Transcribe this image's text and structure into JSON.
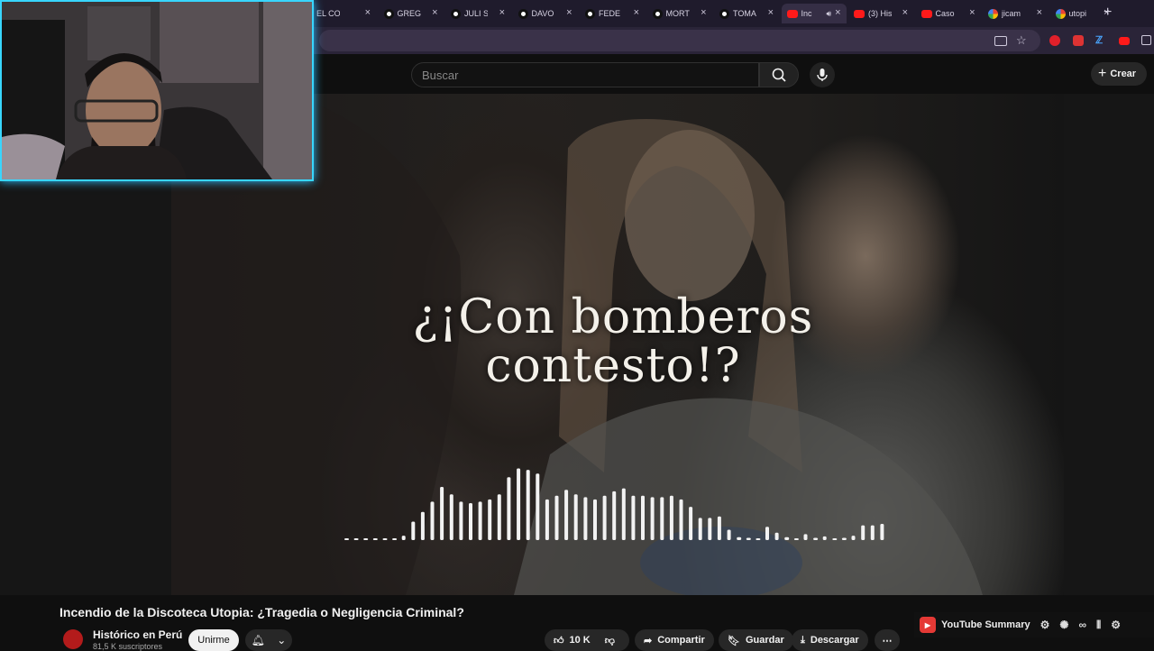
{
  "browser": {
    "tabs": [
      {
        "title": "EL CO",
        "icon": "threads-icon"
      },
      {
        "title": "GREG",
        "icon": "threads-icon"
      },
      {
        "title": "JULI S",
        "icon": "threads-icon"
      },
      {
        "title": "DAVO",
        "icon": "threads-icon"
      },
      {
        "title": "FEDE",
        "icon": "threads-icon"
      },
      {
        "title": "MORT",
        "icon": "threads-icon"
      },
      {
        "title": "TOMA",
        "icon": "threads-icon"
      },
      {
        "title": "Inc",
        "icon": "youtube-icon",
        "active": true
      },
      {
        "title": "(3) His",
        "icon": "youtube-icon"
      },
      {
        "title": "Caso",
        "icon": "youtube-icon"
      },
      {
        "title": "jicam",
        "icon": "google-icon"
      },
      {
        "title": "utopi",
        "icon": "google-icon"
      }
    ],
    "tab_close_glyph": "×",
    "new_tab_glyph": "+"
  },
  "youtube": {
    "search_placeholder": "Buscar",
    "create_label": "Crear",
    "video_caption_line1": "¿¡Con bomberos",
    "video_caption_line2": "contesto!?",
    "video_title": "Incendio de la Discoteca Utopia: ¿Tragedia o Negligencia Criminal?",
    "channel_name": "Histórico en Perú",
    "subscribers": "81,5 K suscriptores",
    "join_label": "Unirme",
    "likes": "10 K",
    "share_label": "Compartir",
    "save_label": "Guardar",
    "download_label": "Descargar",
    "more_glyph": "⋯"
  },
  "extension": {
    "summary_label": "YouTube Summary"
  },
  "waveform": [
    0.02,
    0.02,
    0.02,
    0.02,
    0.02,
    0.02,
    0.06,
    0.25,
    0.38,
    0.52,
    0.72,
    0.62,
    0.52,
    0.5,
    0.52,
    0.55,
    0.62,
    0.85,
    0.97,
    0.95,
    0.9,
    0.55,
    0.6,
    0.68,
    0.62,
    0.58,
    0.55,
    0.6,
    0.66,
    0.7,
    0.6,
    0.6,
    0.58,
    0.58,
    0.6,
    0.55,
    0.45,
    0.3,
    0.3,
    0.32,
    0.14,
    0.04,
    0.03,
    0.02,
    0.18,
    0.1,
    0.04,
    0.02,
    0.08,
    0.03,
    0.05,
    0.02,
    0.03,
    0.06,
    0.2,
    0.2,
    0.22
  ]
}
